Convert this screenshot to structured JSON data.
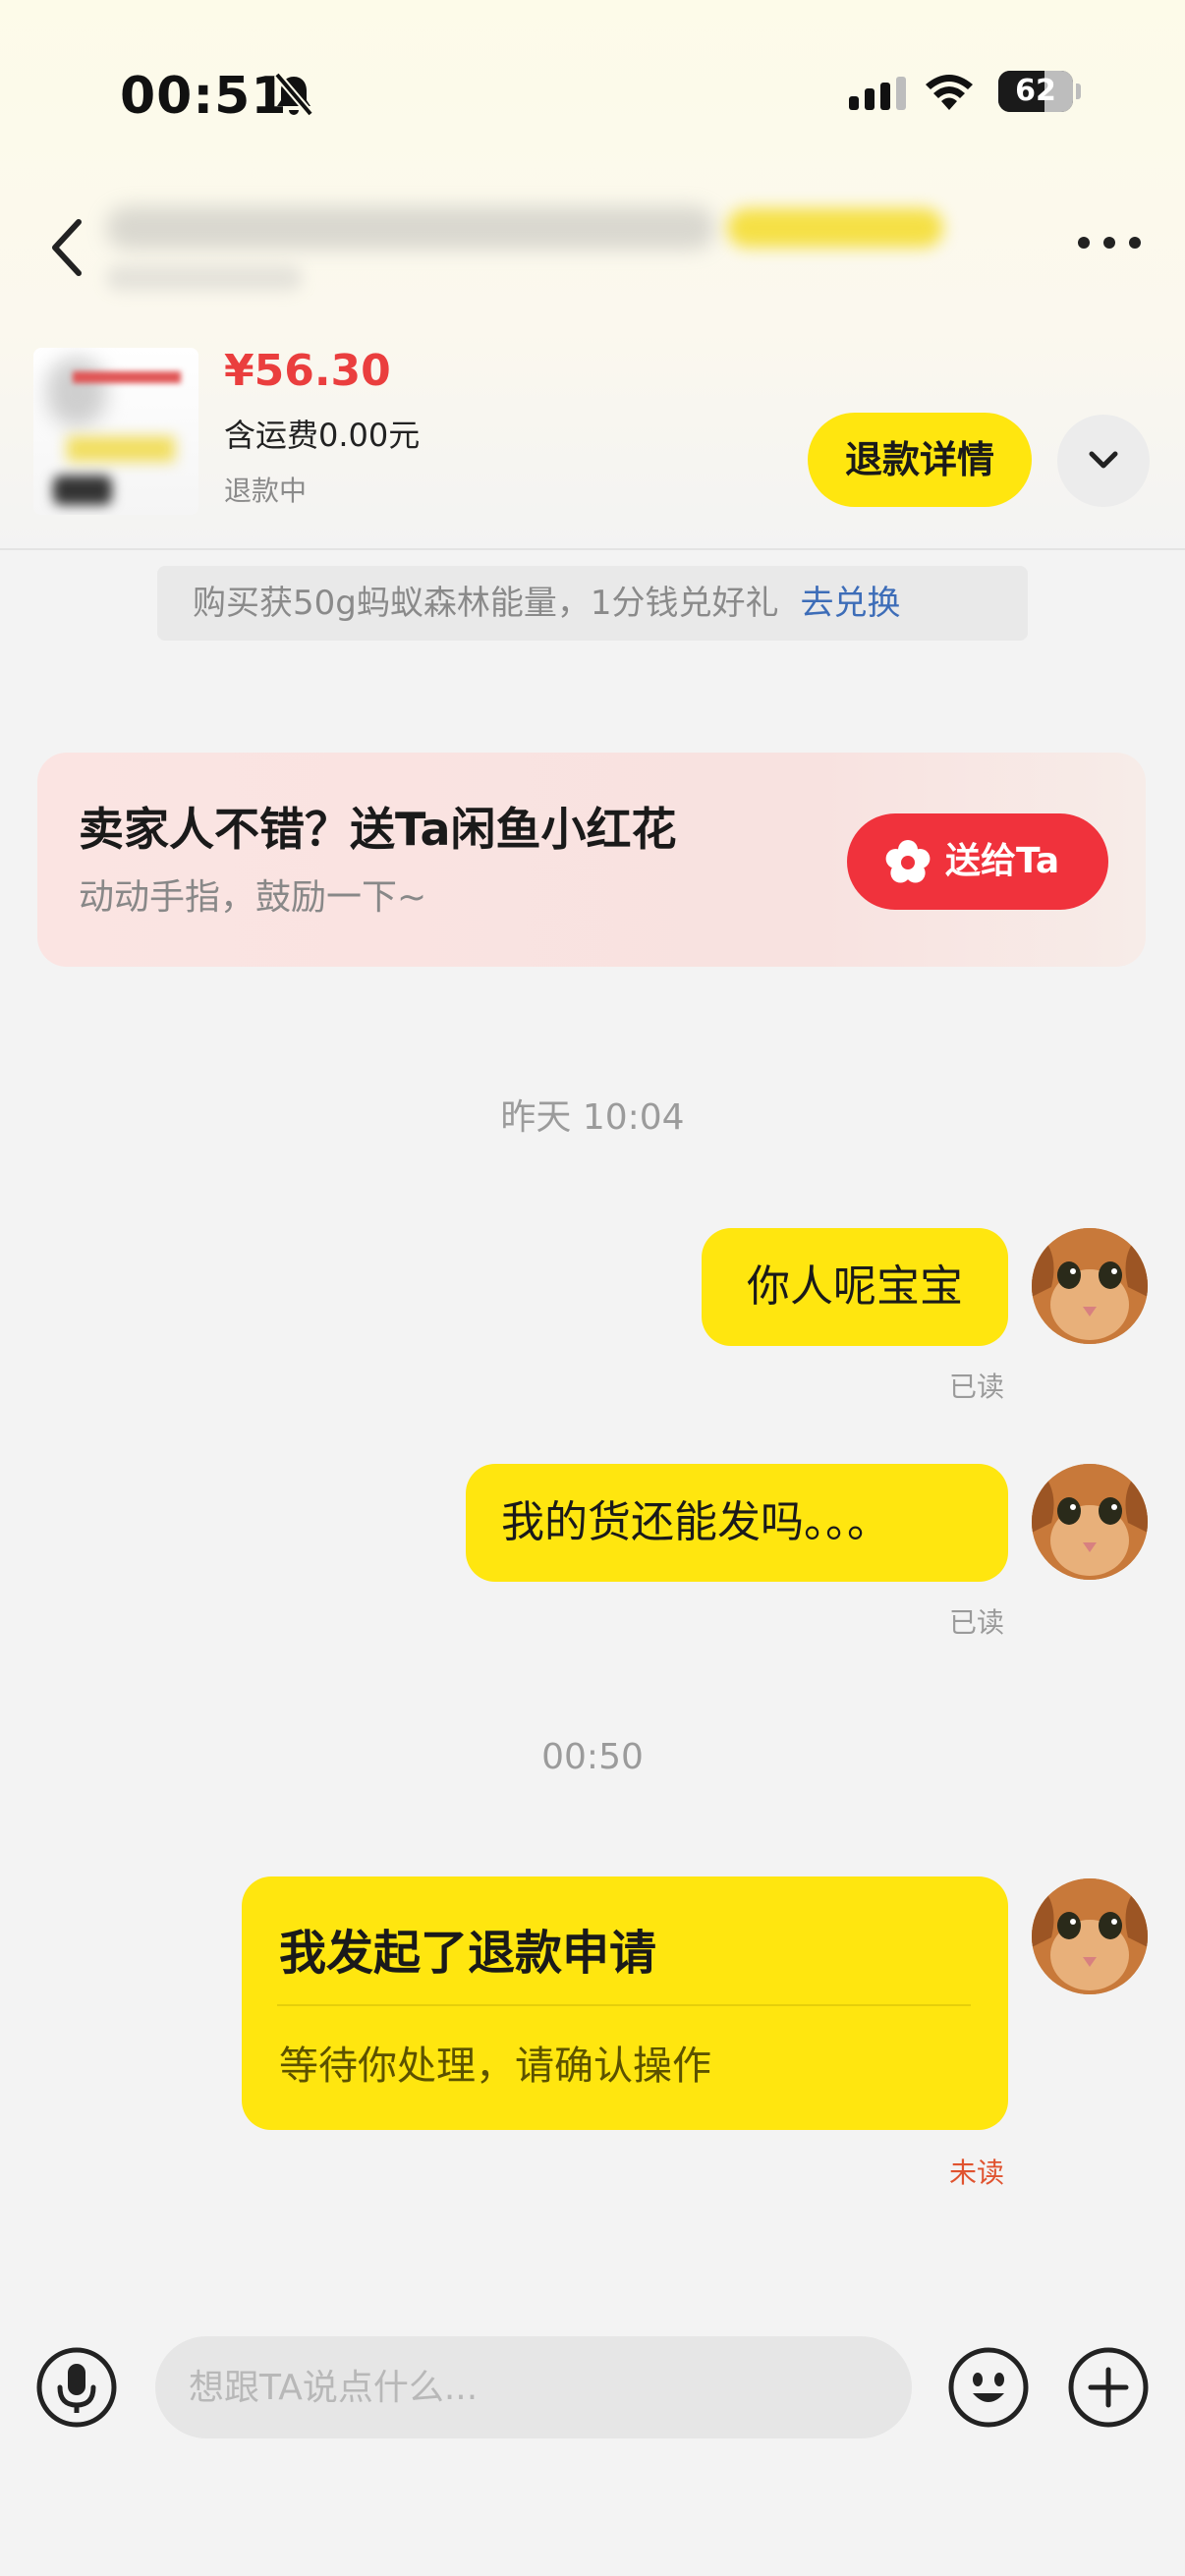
{
  "status_bar": {
    "time": "00:51",
    "battery": "62",
    "battery_level": 0.62
  },
  "nav": {
    "title": "",
    "subtitle": ""
  },
  "product": {
    "price": "¥56.30",
    "shipping": "含运费0.00元",
    "status": "退款中",
    "refund_detail_label": "退款详情"
  },
  "promo": {
    "text": "购买获50g蚂蚁森林能量，1分钱兑好礼",
    "link": "去兑换"
  },
  "flower_card": {
    "title": "卖家人不错？送Ta闲鱼小红花",
    "subtitle": "动动手指，鼓励一下~",
    "button": "送给Ta"
  },
  "messages": {
    "timestamp1": "昨天 10:04",
    "msg1": "你人呢宝宝",
    "read1": "已读",
    "msg2": "我的货还能发吗。。。",
    "read2": "已读",
    "timestamp2": "00:50",
    "refund_card": {
      "title": "我发起了退款申请",
      "subtitle": "等待你处理，请确认操作"
    },
    "read3": "未读"
  },
  "input": {
    "placeholder": "想跟TA说点什么..."
  },
  "colors": {
    "accent": "#ffe60f",
    "price": "#ea3e3e",
    "send": "#f0323c",
    "link": "#3d6db8",
    "unread": "#e0532f"
  },
  "icons": [
    "back-icon",
    "more-icon",
    "chevron-down-icon",
    "bell-slash-icon",
    "signal-icon",
    "wifi-icon",
    "flower-icon",
    "mic-icon",
    "emoji-icon",
    "plus-icon"
  ]
}
